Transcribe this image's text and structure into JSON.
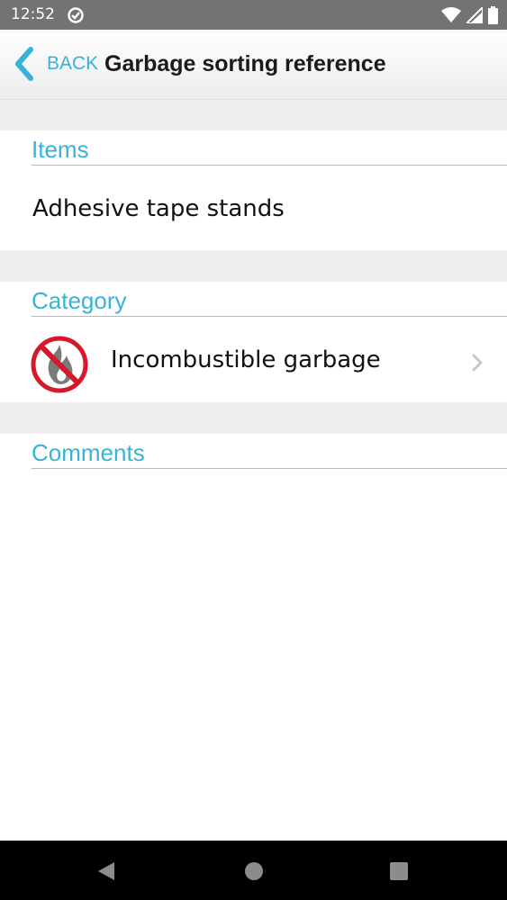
{
  "status_bar": {
    "time": "12:52",
    "icons": [
      "sync-icon",
      "wifi-icon",
      "signal-icon",
      "battery-icon"
    ]
  },
  "toolbar": {
    "back_label": "BACK",
    "title": "Garbage sorting reference"
  },
  "sections": {
    "items": {
      "header": "Items",
      "value": "Adhesive tape stands"
    },
    "category": {
      "header": "Category",
      "value": "Incombustible garbage",
      "icon": "no-fire-icon"
    },
    "comments": {
      "header": "Comments",
      "value": ""
    }
  },
  "nav_bar": {
    "buttons": [
      "back-nav-icon",
      "home-nav-icon",
      "recents-nav-icon"
    ]
  },
  "colors": {
    "accent": "#37b3d9",
    "status_bar": "#737373",
    "gap": "#efefef",
    "no_sign_red": "#d7182a"
  }
}
